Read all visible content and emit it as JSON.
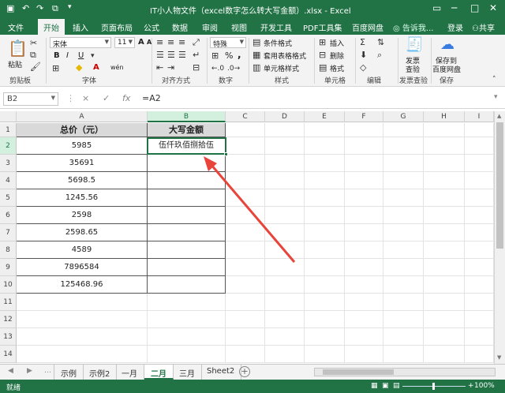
{
  "titlebar": {
    "title": "IT小人物文件（excel数字怎么转大写金额）.xlsx - Excel",
    "save_icon": "save-icon",
    "undo_icon": "undo-icon",
    "redo_icon": "redo-icon",
    "preview_icon": "print-preview-icon",
    "customize_icon": "customize-icon",
    "controls": [
      "restore-icon",
      "minimize-icon",
      "maximize-icon",
      "close-icon"
    ]
  },
  "tabs": {
    "items": [
      "文件",
      "开始",
      "插入",
      "页面布局",
      "公式",
      "数据",
      "审阅",
      "视图",
      "开发工具",
      "PDF工具集",
      "百度网盘"
    ],
    "active": "开始",
    "tellme": "告诉我...",
    "login": "登录",
    "share": "共享"
  },
  "ribbon": {
    "clipboard": {
      "paste": "粘贴",
      "label": "剪贴板"
    },
    "font": {
      "name": "宋体",
      "size": "11",
      "label": "字体",
      "bold": "B",
      "italic": "I",
      "underline": "U",
      "grow": "A",
      "shrink": "A",
      "wen": "wén"
    },
    "align": {
      "label": "对齐方式"
    },
    "number": {
      "format": "特殊",
      "percent": "%",
      "comma": ",",
      "label": "数字"
    },
    "styles": {
      "conditional": "条件格式",
      "table": "套用表格格式",
      "cell": "单元格样式",
      "label": "样式"
    },
    "cells": {
      "insert": "插入",
      "delete": "删除",
      "format": "格式",
      "label": "单元格"
    },
    "editing": {
      "label": "编辑"
    },
    "invoice": {
      "line1": "发票",
      "line2": "查验",
      "label": "发票查验"
    },
    "save": {
      "line1": "保存到",
      "line2": "百度网盘",
      "label": "保存"
    }
  },
  "formulabar": {
    "namebox": "B2",
    "cancel": "×",
    "enter": "✓",
    "fx": "fx",
    "formula": "=A2"
  },
  "grid": {
    "columns": [
      "A",
      "B",
      "C",
      "D",
      "E",
      "F",
      "G",
      "H",
      "I"
    ],
    "rows": [
      "1",
      "2",
      "3",
      "4",
      "5",
      "6",
      "7",
      "8",
      "9",
      "10",
      "11",
      "12",
      "13",
      "14"
    ],
    "header_a": "总价（元）",
    "header_b": "大写金额",
    "values_a": [
      "5985",
      "35691",
      "5698.5",
      "1245.56",
      "2598",
      "2598.65",
      "4589",
      "7896584",
      "125468.96"
    ],
    "b2": "伍仟玖佰捌拾伍",
    "selected": "B2",
    "arrow_color": "#e8443a"
  },
  "sheets": {
    "items": [
      "示例",
      "示例2",
      "一月",
      "二月",
      "三月",
      "Sheet2"
    ],
    "active": "二月"
  },
  "status": {
    "ready": "就绪",
    "zoom": "100%"
  },
  "colors": {
    "brand": "#217346"
  }
}
